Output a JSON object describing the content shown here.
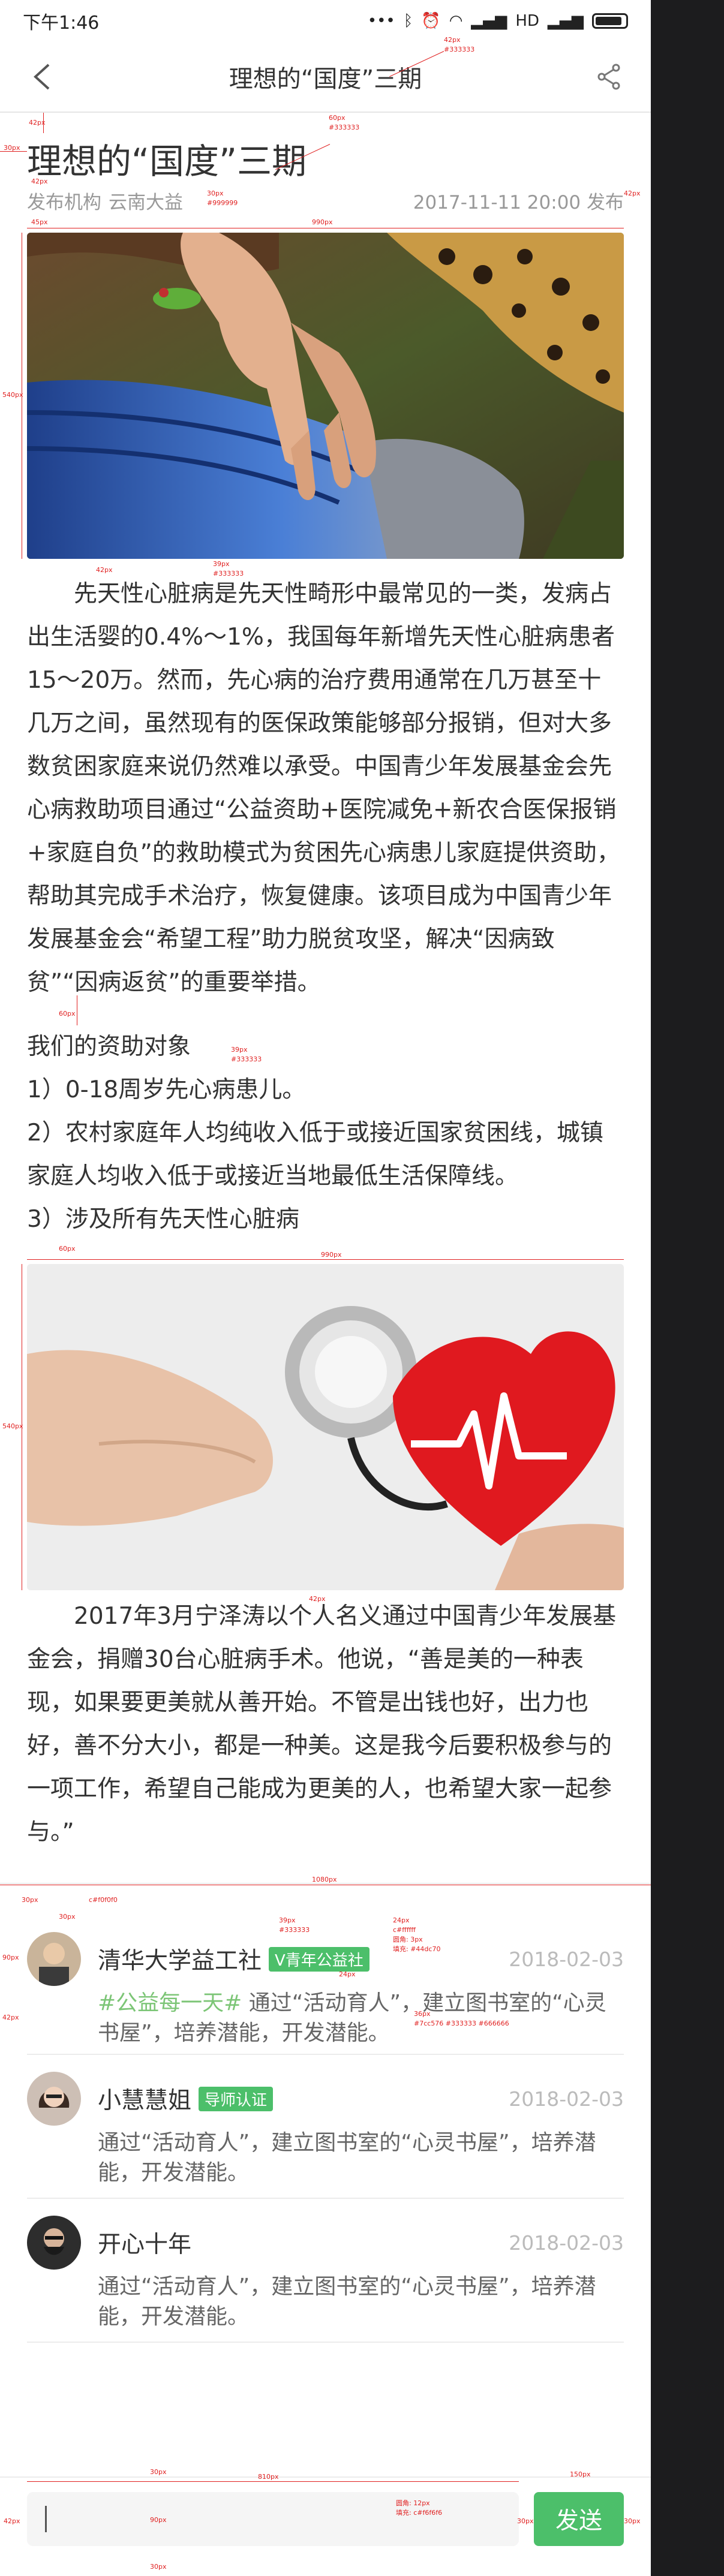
{
  "status_bar": {
    "time": "下午1:46",
    "network": "HD"
  },
  "nav": {
    "title": "理想的“国度”三期",
    "back_icon": "chevron-left-icon",
    "share_icon": "share-icon"
  },
  "article": {
    "title": "理想的“国度”三期",
    "org_label": "发布机构",
    "org_name": "云南大益",
    "date": "2017-11-11 20:00 发布",
    "paragraph1": "先天性心脏病是先天性畸形中最常见的一类，发病占出生活婴的0.4%～1%，我国每年新增先天性心脏病患者15～20万。然而，先心病的治疗费用通常在几万甚至十几万之间，虽然现有的医保政策能够部分报销，但对大多数贫困家庭来说仍然难以承受。中国青少年发展基金会先心病救助项目通过“公益资助+医院减免+新农合医保报销+家庭自负”的救助模式为贫困先心病患儿家庭提供资助，帮助其完成手术治疗，恢复健康。该项目成为中国青少年发展基金会“希望工程”助力脱贫攻坚，解决“因病致贫”“因病返贫”的重要举措。",
    "list_title": "我们的资助对象",
    "list_items": [
      "1）0-18周岁先心病患儿。",
      "2）农村家庭年人均纯收入低于或接近国家贫困线，城镇家庭人均收入低于或接近当地最低生活保障线。",
      "3）涉及所有先天性心脏病"
    ],
    "paragraph2": "2017年3月宁泽涛以个人名义通过中国青少年发展基金会，捐赠30台心脏病手术。他说，“善是美的一种表现，如果要更美就从善开始。不管是出钱也好，出力也好，善不分大小，都是一种美。这是我今后要积极参与的一项工作，希望自己能成为更美的人，也希望大家一起参与。”"
  },
  "comments": [
    {
      "name": "清华大学益工社",
      "tag": "V青年公益社",
      "date": "2018-02-03",
      "hashtag": "#公益每一天#",
      "text": "通过“活动育人”，建立图书室的“心灵书屋”，培养潜能，开发潜能。"
    },
    {
      "name": "小慧慧姐",
      "tag": "导师认证",
      "date": "2018-02-03",
      "hashtag": "",
      "text": "通过“活动育人”，建立图书室的“心灵书屋”，培养潜能，开发潜能。"
    },
    {
      "name": "开心十年",
      "tag": "",
      "date": "2018-02-03",
      "hashtag": "",
      "text": "通过“活动育人”，建立图书室的“心灵书屋”，培养潜能，开发潜能。"
    }
  ],
  "bottom_bar": {
    "placeholder": "",
    "send_label": "发送"
  },
  "annotations": {
    "a1": "42px",
    "a2": "#333333",
    "a3": "60px",
    "a4": "#333333",
    "a5": "42px",
    "a6": "30px",
    "a7": "30px",
    "a8": "#999999",
    "a9": "42px",
    "a10": "45px",
    "a11": "990px",
    "a12": "540px",
    "a13": "42px",
    "a14": "39px",
    "a15": "#333333",
    "a16": "60px",
    "a17": "39px",
    "a18": "#333333",
    "a19": "60px",
    "a20": "990px",
    "a21": "540px",
    "a22": "42px",
    "a23": "1080px",
    "a24": "30px",
    "a25": "c#f0f0f0",
    "a26": "90px",
    "a27": "30px",
    "a28": "39px",
    "a29": "#333333",
    "a30": "24px",
    "a31": "c#ffffff",
    "a32": "圆角: 3px",
    "a33": "填充: #44dc70",
    "a34": "24px",
    "a35": "36px",
    "a36": "#7cc576 #333333 #666666",
    "a37": "30px",
    "a38": "42px",
    "a39": "42px",
    "a40": "30px",
    "a41": "90px",
    "a42": "30px",
    "a43": "810px",
    "a44": "圆角: 12px",
    "a45": "填充: c#f6f6f6",
    "a46": "150px",
    "a47": "30px",
    "a48": "42px",
    "a49": "24px",
    "a50": "30px"
  },
  "colors": {
    "accent": "#4cbf6a",
    "text": "#333333",
    "muted": "#999999",
    "hashtag": "#7cc576",
    "annotation": "#e02020"
  }
}
